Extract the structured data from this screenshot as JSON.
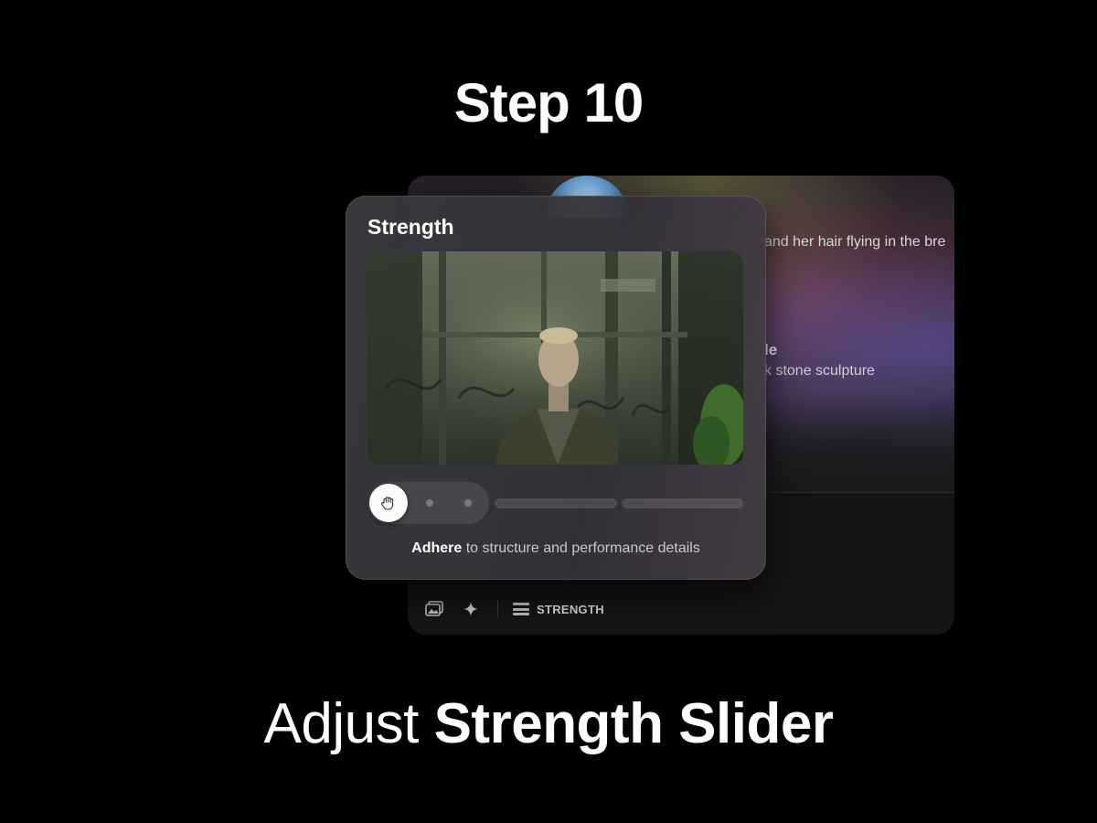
{
  "header": {
    "step_title": "Step 10"
  },
  "back_panel": {
    "prompt_fragment": "and her hair flying in the bre",
    "style_title_fragment": "le",
    "style_desc_fragment": "k stone sculpture",
    "toolbar": {
      "icons": [
        "image-gallery-icon",
        "sparkle-icon",
        "strength-bars-icon"
      ],
      "strength_label": "STRENGTH"
    }
  },
  "strength_card": {
    "title": "Strength",
    "slider": {
      "position": 0,
      "steps": 5
    },
    "hint_bold": "Adhere",
    "hint_rest": " to structure and performance details"
  },
  "caption": {
    "light": "Adjust ",
    "bold": "Strength Slider"
  },
  "colors": {
    "background": "#000000",
    "card": "#3a3a3e",
    "knob": "#fbfbfb"
  }
}
